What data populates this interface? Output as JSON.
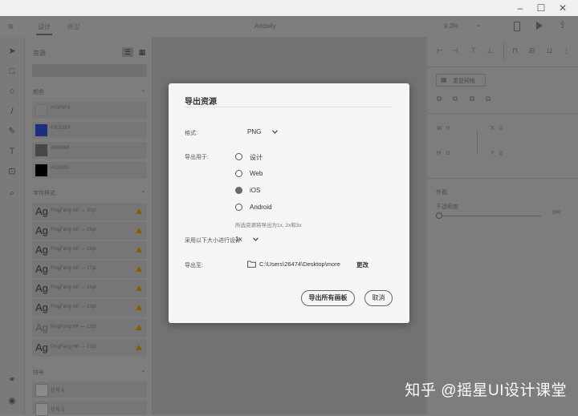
{
  "app": {
    "title": "Artdaily",
    "tabs": [
      "设计",
      "原型"
    ],
    "zoom": "9.3%"
  },
  "left_panel": {
    "assets_title": "资源",
    "colors_section": "颜色",
    "colors": [
      {
        "hex": "#F0F0F0",
        "label": "#F0F0F0"
      },
      {
        "hex": "#3C53EF",
        "label": "#3C53EF"
      },
      {
        "hex": "#888888",
        "label": "#888888"
      },
      {
        "hex": "#000000",
        "label": "#000000"
      }
    ],
    "char_styles_section": "字符样式",
    "char_styles": [
      {
        "glyph": "Ag",
        "label": "PingFang HK — 30pt"
      },
      {
        "glyph": "Ag",
        "label": "PingFang HK — 26pt"
      },
      {
        "glyph": "Ag",
        "label": "PingFang HK — 18pt"
      },
      {
        "glyph": "Ag",
        "label": "PingFang HK — 17pt"
      },
      {
        "glyph": "Ag",
        "label": "PingFang HK — 14pt"
      },
      {
        "glyph": "Ag",
        "label": "PingFang HK — 13pt"
      },
      {
        "glyph": "Ag",
        "label": "PingFang HK — 12pt"
      },
      {
        "glyph": "Ag",
        "label": "PingFang HK — 12pt"
      }
    ],
    "symbols_section": "符号",
    "symbols": [
      "符号 6",
      "符号 5"
    ]
  },
  "right_panel": {
    "repeat_grid": "重复网格",
    "w_label": "W",
    "w_value": "0",
    "x_label": "X",
    "x_value": "0",
    "h_label": "H",
    "h_value": "0",
    "y_label": "Y",
    "y_value": "0",
    "appearance_title": "外观",
    "opacity_label": "不透明度",
    "opacity_value": "0%"
  },
  "dialog": {
    "title": "导出资源",
    "format_label": "格式:",
    "format_value": "PNG",
    "export_for_label": "导出用于:",
    "options": [
      {
        "label": "设计",
        "selected": false
      },
      {
        "label": "Web",
        "selected": false
      },
      {
        "label": "iOS",
        "selected": true
      },
      {
        "label": "Android",
        "selected": false
      }
    ],
    "hint": "所选资源将导出为1x, 2x和3x",
    "scale_label": "采用以下大小进行设计",
    "scale_value": "1x",
    "export_to_label": "导出至:",
    "path": "C:\\Users\\26474\\Desktop\\more",
    "change_label": "更改",
    "export_all_button": "导出所有画板",
    "cancel_button": "取消"
  },
  "watermark": "知乎 @摇星UI设计课堂"
}
